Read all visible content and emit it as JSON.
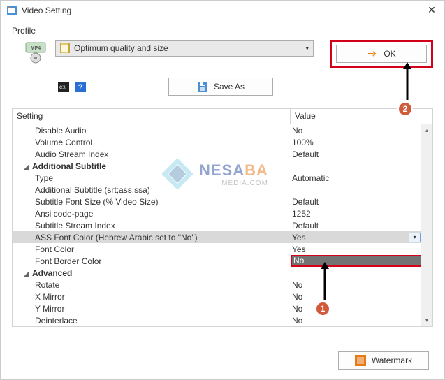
{
  "window": {
    "title": "Video Setting"
  },
  "profile": {
    "label": "Profile",
    "selected": "Optimum quality and size",
    "save_as": "Save As",
    "ok": "OK"
  },
  "grid": {
    "headers": {
      "setting": "Setting",
      "value": "Value"
    },
    "rows": [
      {
        "name": "Disable Audio",
        "value": "No"
      },
      {
        "name": "Volume Control",
        "value": "100%"
      },
      {
        "name": "Audio Stream Index",
        "value": "Default"
      },
      {
        "group": true,
        "name": "Additional Subtitle"
      },
      {
        "name": "Type",
        "value": "Automatic"
      },
      {
        "name": "Additional Subtitle (srt;ass;ssa)",
        "value": ""
      },
      {
        "name": "Subtitle Font Size (% Video Size)",
        "value": "Default"
      },
      {
        "name": "Ansi code-page",
        "value": "1252"
      },
      {
        "name": "Subtitle Stream Index",
        "value": "Default"
      },
      {
        "name": "ASS Font Color (Hebrew Arabic set to \"No\")",
        "value": "Yes",
        "selected": true
      },
      {
        "name": "Font Color",
        "value": "Yes"
      },
      {
        "name": "Font Border Color",
        "value": "No",
        "dd_open": true
      },
      {
        "group": true,
        "name": "Advanced"
      },
      {
        "name": "Rotate",
        "value": "No"
      },
      {
        "name": "X Mirror",
        "value": "No"
      },
      {
        "name": "Y Mirror",
        "value": "No"
      },
      {
        "name": "Deinterlace",
        "value": "No"
      }
    ]
  },
  "watermark_btn": "Watermark",
  "logo": {
    "line1a": "NESA",
    "line1b": "BA",
    "line2": "MEDIA.COM"
  },
  "annotations": {
    "badge1": "1",
    "badge2": "2"
  }
}
